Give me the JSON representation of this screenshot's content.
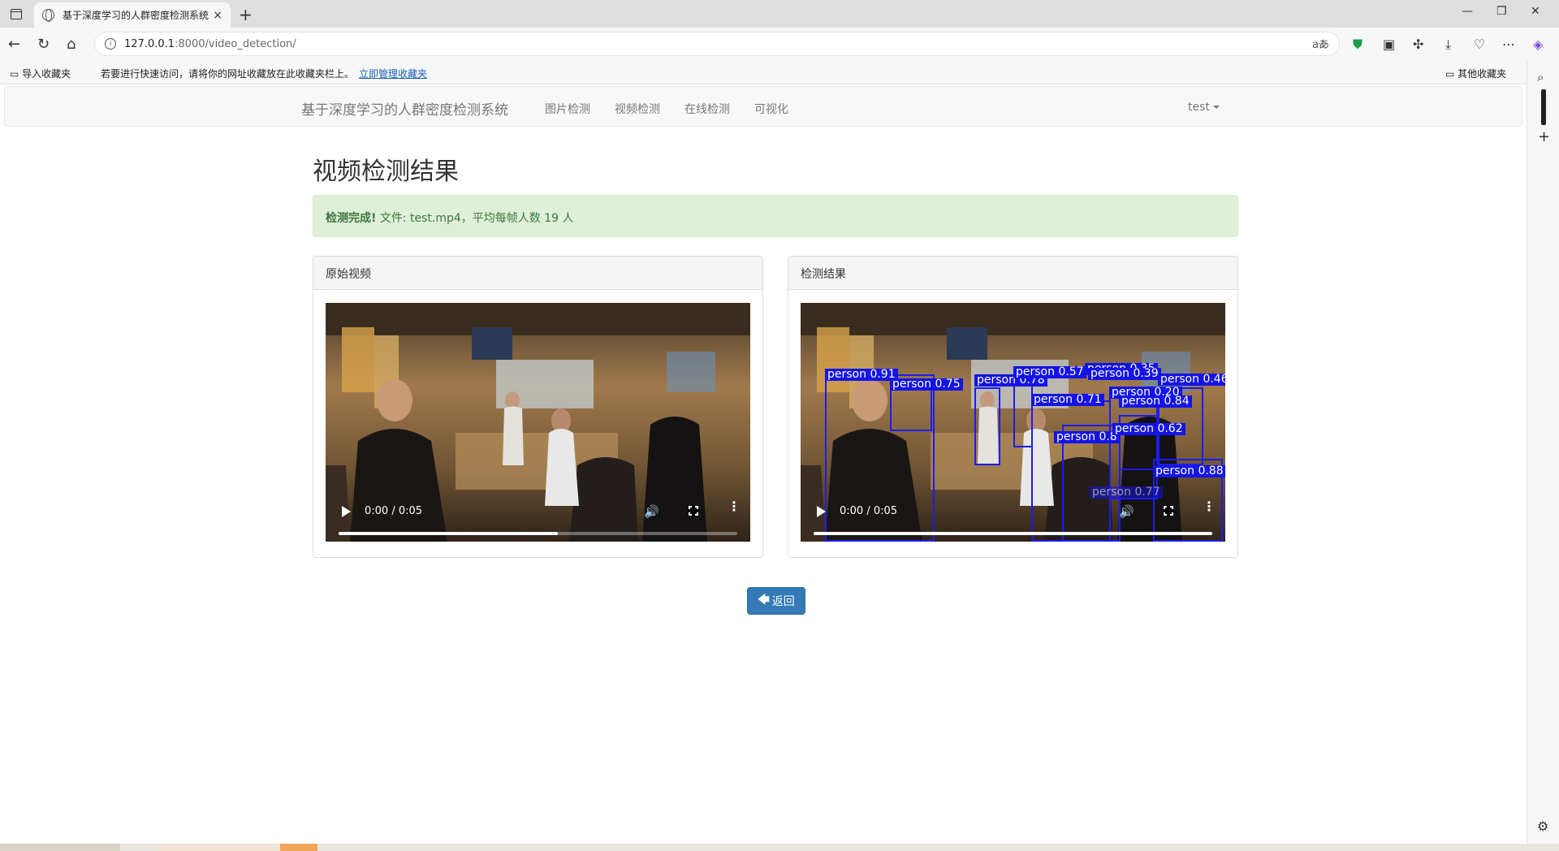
{
  "browser": {
    "tab_title": "基于深度学习的人群密度检测系统",
    "tab_close": "×",
    "new_tab": "+",
    "url_host": "127.0.0.1",
    "url_rest": ":8000/video_detection/",
    "read_aloud": "aあ",
    "bookmarks_bar": {
      "import_label": "导入收藏夹",
      "hint_text": "若要进行快速访问，请将你的网址收藏放在此收藏夹栏上。",
      "manage_link": "立即管理收藏夹",
      "other_label": "其他收藏夹"
    }
  },
  "navbar": {
    "brand": "基于深度学习的人群密度检测系统",
    "links": [
      "图片检测",
      "视频检测",
      "在线检测",
      "可视化"
    ],
    "user": "test"
  },
  "page": {
    "title": "视频检测结果",
    "alert_strong": "检测完成!",
    "alert_text": " 文件: test.mp4，平均每帧人数 19 人",
    "panels": {
      "original_heading": "原始视频",
      "result_heading": "检测结果"
    },
    "video": {
      "time": "0:00 / 0:05",
      "progress_original": 0.55,
      "progress_result": 1.0
    },
    "detections": [
      "person 0.91",
      "person 0.75",
      "person 0.78",
      "person 0.57",
      "person 0.35",
      "person 0.46",
      "person 0.20",
      "person 0.84",
      "person 0.71",
      "person 0.8",
      "person 0.62",
      "person 0.88",
      "person 0.77",
      "person 0.39"
    ],
    "back_button": "返回"
  },
  "colors": {
    "alert_bg": "#dff0d8",
    "alert_text": "#3c763d",
    "primary": "#337ab7",
    "detection": "#1414e6"
  }
}
